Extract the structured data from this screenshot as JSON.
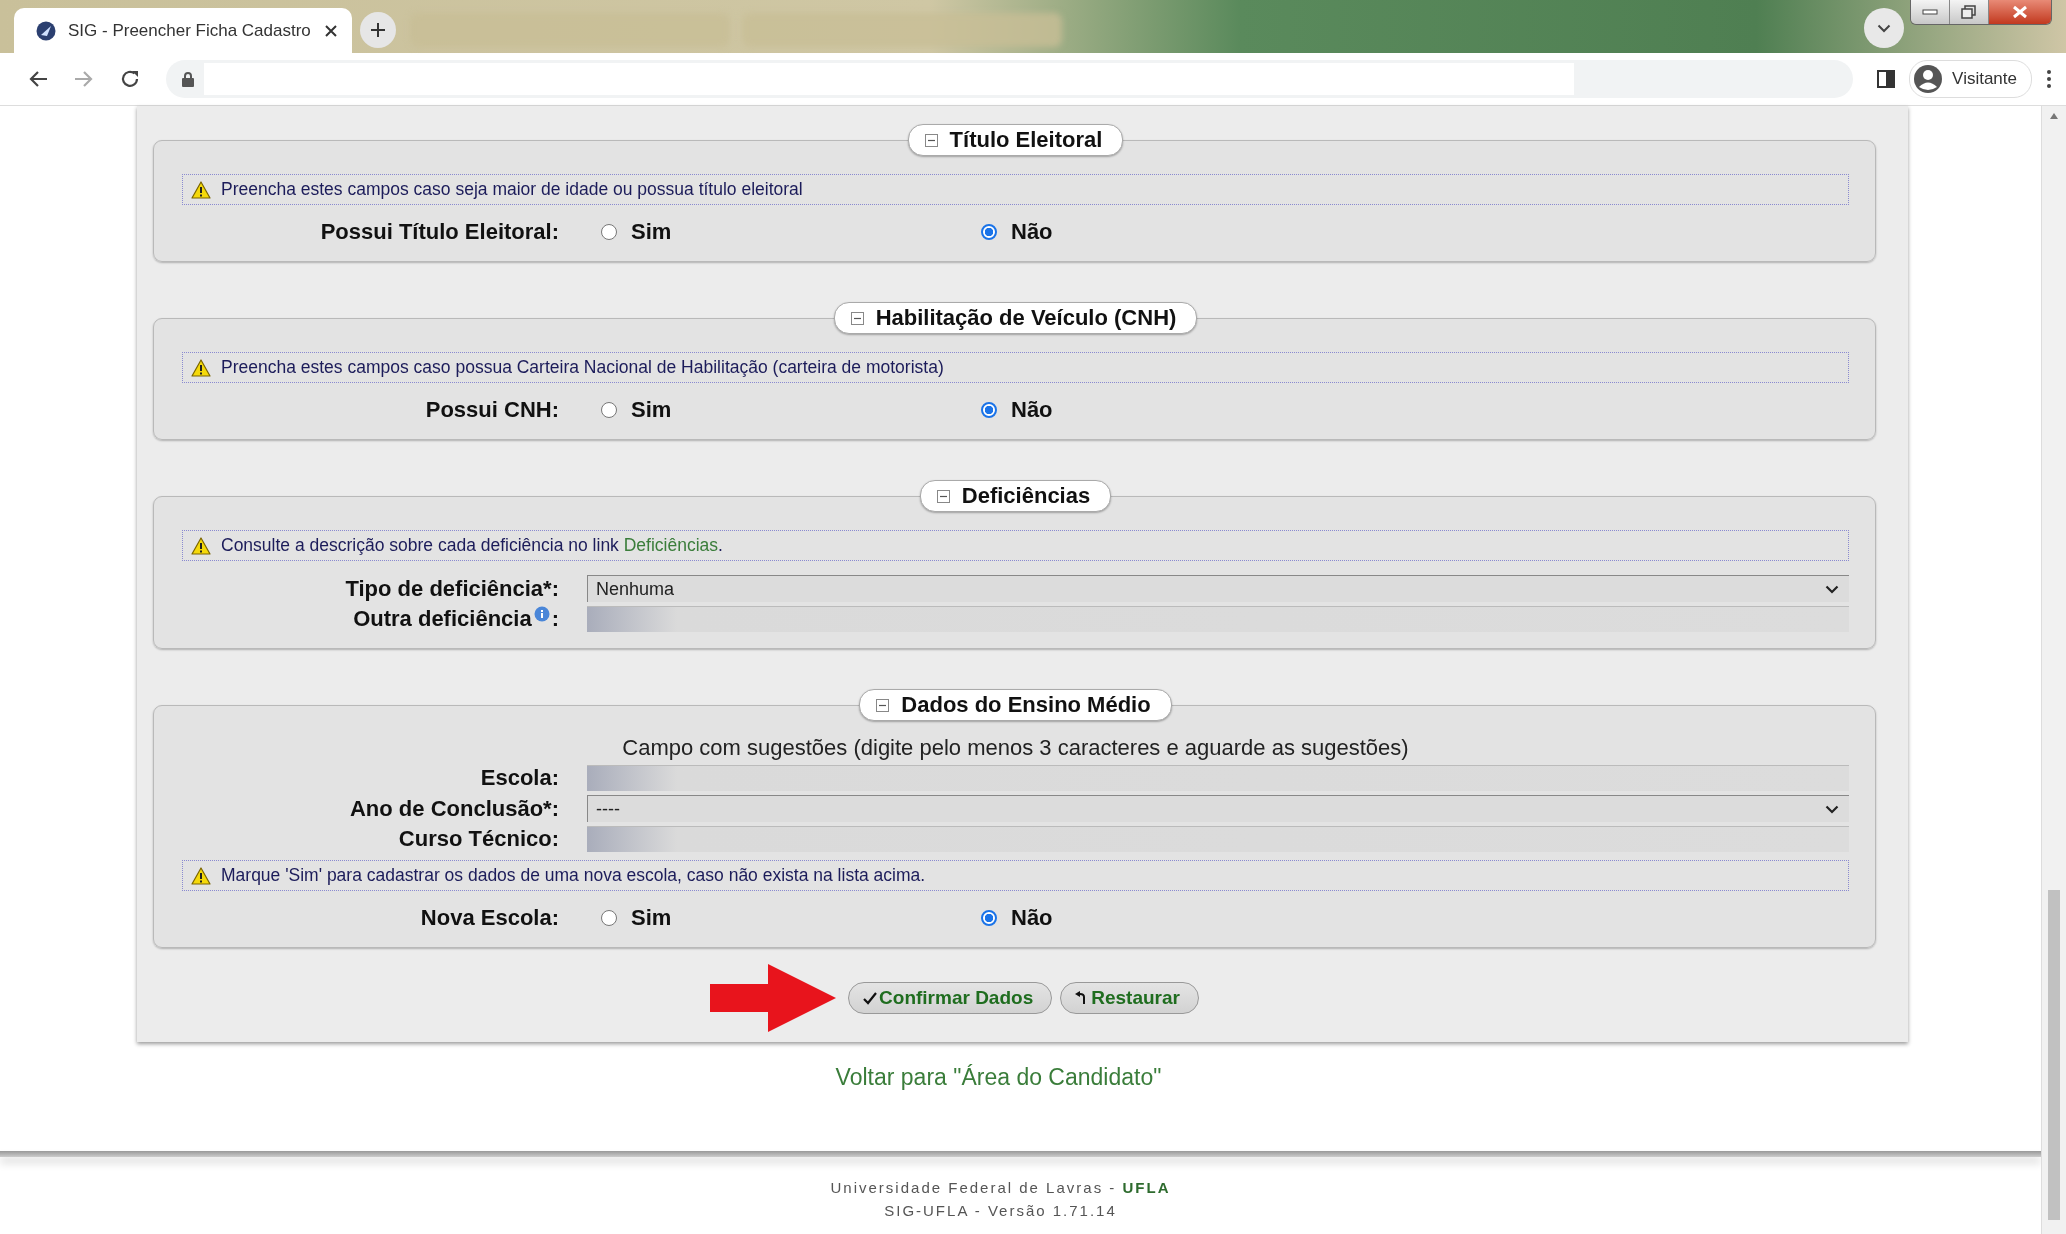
{
  "browser": {
    "tabs": [
      {
        "title": "SIG - Preencher Ficha Cadastro",
        "selected": true
      },
      {
        "selected": false
      },
      {
        "selected": false
      }
    ],
    "profile": "Visitante"
  },
  "sections": [
    {
      "title": "Título Eleitoral",
      "rows": [
        {
          "kind": "notice",
          "text": "Preencha estes campos caso seja maior de idade ou possua título eleitoral"
        },
        {
          "kind": "radio",
          "label": "Possui Título Eleitoral:",
          "options": [
            {
              "label": "Sim",
              "selected": false
            },
            {
              "label": "Não",
              "selected": true
            }
          ]
        }
      ]
    },
    {
      "title": "Habilitação de Veículo (CNH)",
      "rows": [
        {
          "kind": "notice",
          "text": "Preencha estes campos caso possua Carteira Nacional de Habilitação (carteira de motorista)"
        },
        {
          "kind": "radio",
          "label": "Possui CNH:",
          "options": [
            {
              "label": "Sim",
              "selected": false
            },
            {
              "label": "Não",
              "selected": true
            }
          ]
        }
      ]
    },
    {
      "title": "Deficiências",
      "rows": [
        {
          "kind": "notice",
          "text": "Consulte a descrição sobre cada deficiência no link ",
          "link": "Deficiências",
          "after": "."
        },
        {
          "kind": "select",
          "label": "Tipo de deficiência*:",
          "value": "Nenhuma"
        },
        {
          "kind": "input",
          "label": "Outra deficiência",
          "info": true,
          "label_end": ":"
        }
      ]
    },
    {
      "title": "Dados do Ensino Médio",
      "rows": [
        {
          "kind": "hint",
          "text": "Campo com sugestões (digite pelo menos 3 caracteres e aguarde as sugestões)"
        },
        {
          "kind": "input",
          "label": "Escola:"
        },
        {
          "kind": "select",
          "label": "Ano de Conclusão*:",
          "value": "----"
        },
        {
          "kind": "input",
          "label": "Curso Técnico:"
        },
        {
          "kind": "notice",
          "text": "Marque 'Sim' para cadastrar os dados de uma nova escola, caso não exista na lista acima."
        },
        {
          "kind": "radio",
          "label": "Nova Escola:",
          "options": [
            {
              "label": "Sim",
              "selected": false
            },
            {
              "label": "Não",
              "selected": true
            }
          ]
        }
      ]
    }
  ],
  "actions": {
    "highlight_arrow": true,
    "buttons": [
      {
        "kind": "confirm",
        "label": "Confirmar Dados"
      },
      {
        "kind": "reset",
        "label": "Restaurar"
      }
    ]
  },
  "back_link": "Voltar para \"Área do Candidato\"",
  "footer": [
    "Universidade Federal de Lavras - **UFLA**",
    "SIG-UFLA - Versão 1.71.14"
  ]
}
